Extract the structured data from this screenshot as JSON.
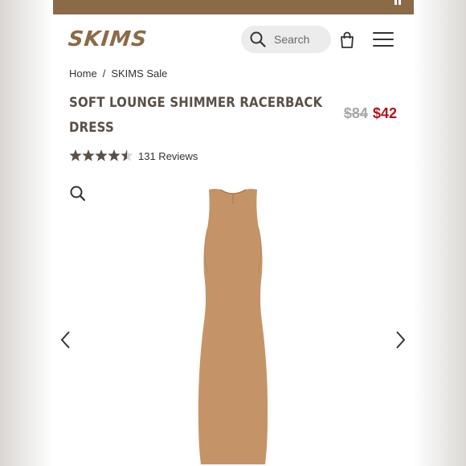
{
  "brand": {
    "logo_text": "SKIMS",
    "accent_color": "#8b6a48"
  },
  "header": {
    "search_label": "Search"
  },
  "breadcrumb": {
    "items": [
      "Home",
      "SKIMS Sale"
    ],
    "separator": "/"
  },
  "product": {
    "title": "SOFT LOUNGE SHIMMER RACERBACK DRESS",
    "original_price": "$84",
    "sale_price": "$42",
    "sale_color": "#b0141c",
    "rating": 4.5,
    "rating_max": 5,
    "reviews": "131 Reviews",
    "dress_color": "#c49468"
  },
  "icons": [
    "search-icon",
    "shopping-bag-icon",
    "hamburger-menu-icon",
    "zoom-icon",
    "chevron-left-icon",
    "chevron-right-icon",
    "star-icon"
  ]
}
